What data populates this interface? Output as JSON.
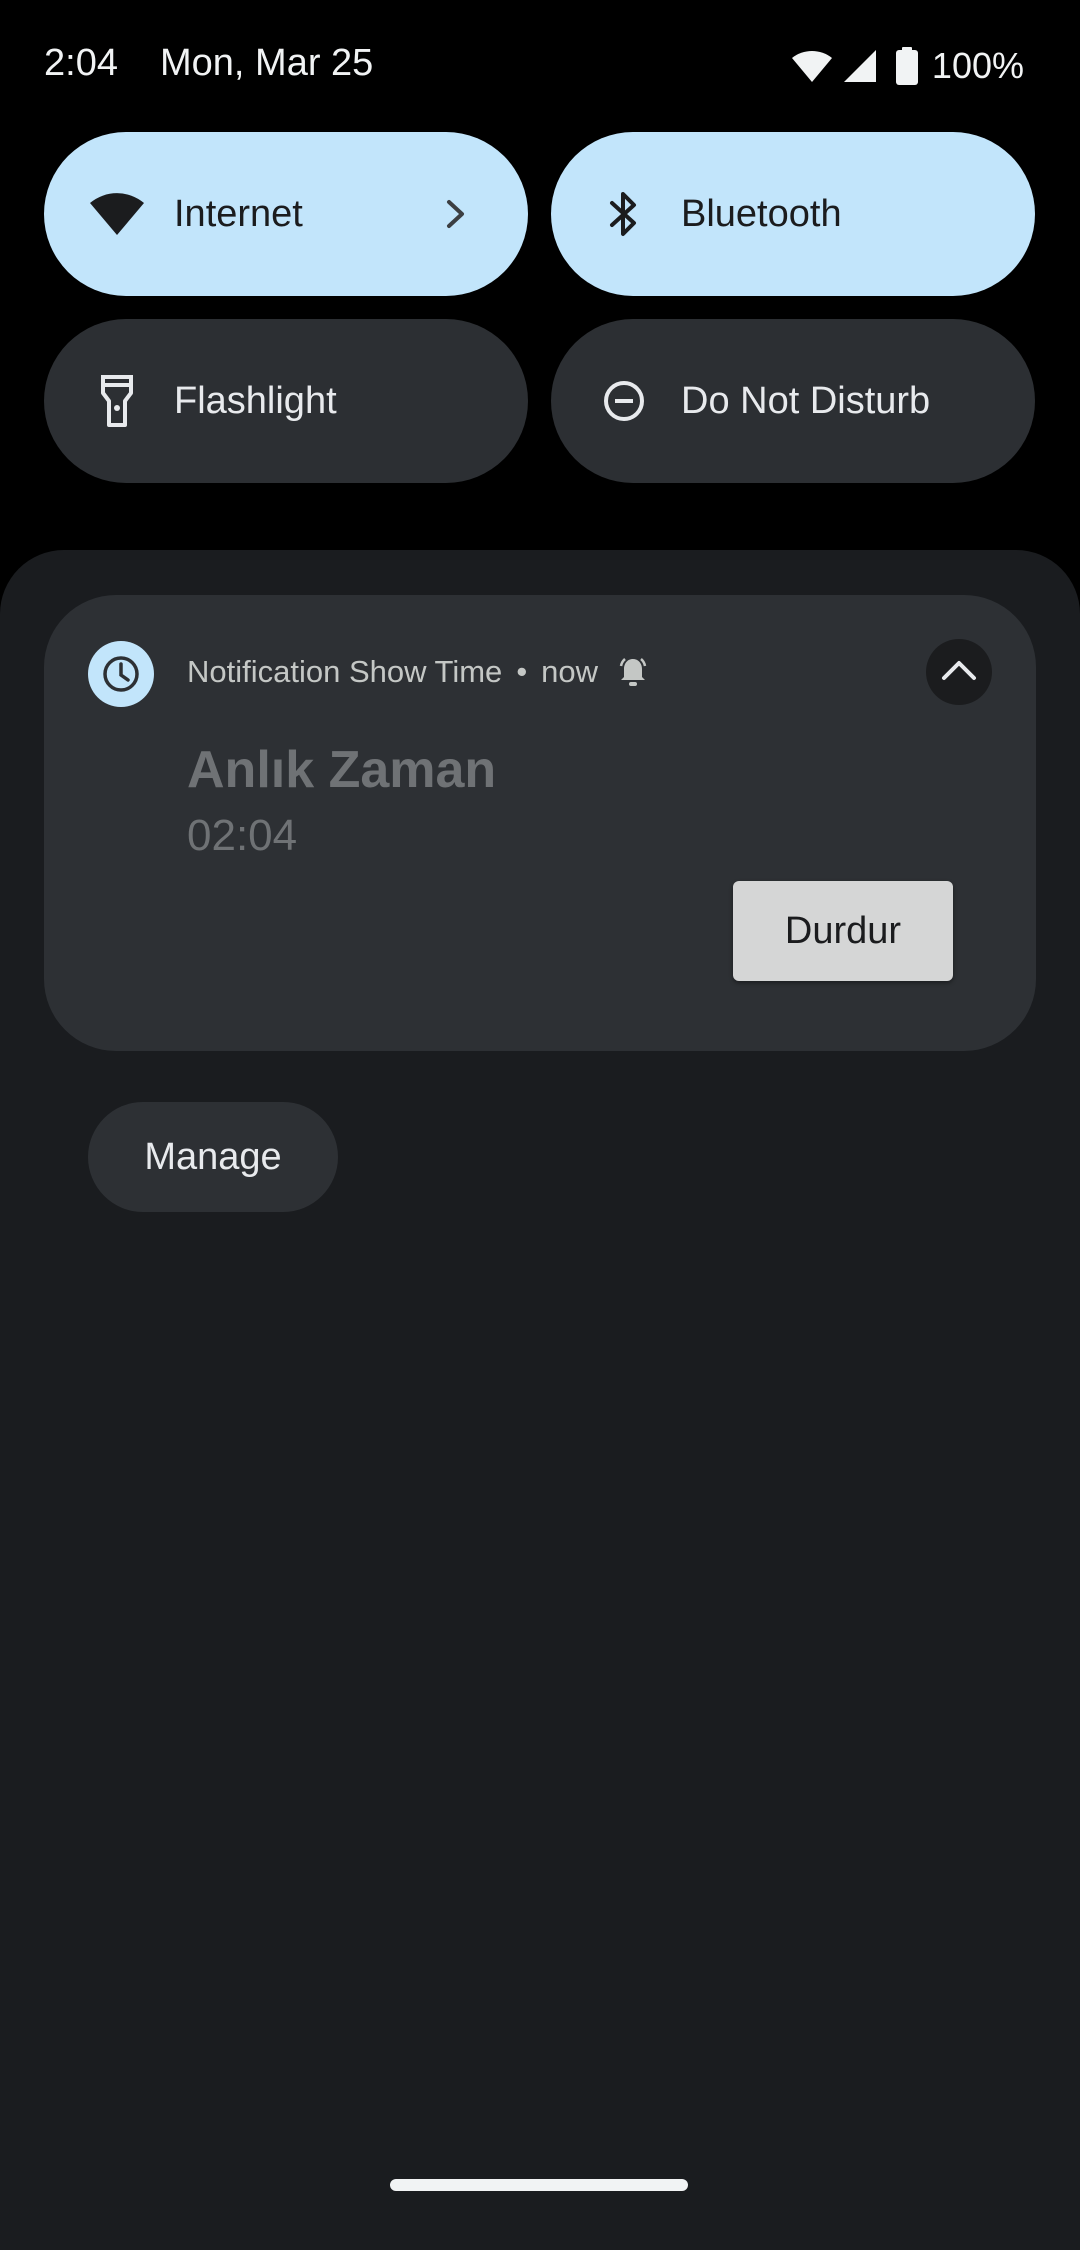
{
  "status_bar": {
    "time": "2:04",
    "date": "Mon, Mar 25",
    "battery": "100%",
    "icons": [
      "wifi-icon",
      "cell-signal-icon",
      "battery-icon"
    ]
  },
  "quick_settings": {
    "tiles": [
      {
        "label": "Internet",
        "icon": "wifi-icon",
        "active": true,
        "has_chevron": true
      },
      {
        "label": "Bluetooth",
        "icon": "bluetooth-icon",
        "active": true
      },
      {
        "label": "Flashlight",
        "icon": "flashlight-icon",
        "active": false
      },
      {
        "label": "Do Not Disturb",
        "icon": "do-not-disturb-icon",
        "active": false
      }
    ]
  },
  "notification": {
    "app_icon": "clock-icon",
    "app_name": "Notification Show Time",
    "separator": "•",
    "time": "now",
    "alert_icon": "bell-icon",
    "title": "Anlık Zaman",
    "text": "02:04",
    "action_label": "Durdur"
  },
  "manage_label": "Manage",
  "colors": {
    "active_tile": "#c2e5fb",
    "inactive_tile": "#2c2f33",
    "shade_background": "#1a1c1f",
    "card_background": "#2d3034"
  }
}
